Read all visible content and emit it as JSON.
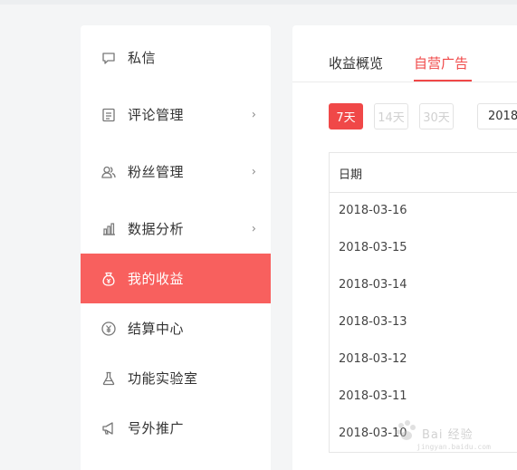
{
  "sidebar": {
    "items": [
      {
        "label": "私信",
        "icon": "message-icon",
        "has_chevron": false,
        "active": false
      },
      {
        "label": "评论管理",
        "icon": "comment-doc-icon",
        "has_chevron": true,
        "active": false
      },
      {
        "label": "粉丝管理",
        "icon": "users-icon",
        "has_chevron": true,
        "active": false
      },
      {
        "label": "数据分析",
        "icon": "bar-chart-icon",
        "has_chevron": true,
        "active": false
      },
      {
        "label": "我的收益",
        "icon": "money-bag-icon",
        "has_chevron": false,
        "active": true
      },
      {
        "label": "结算中心",
        "icon": "yen-circle-icon",
        "has_chevron": false,
        "active": false
      },
      {
        "label": "功能实验室",
        "icon": "flask-icon",
        "has_chevron": false,
        "active": false
      },
      {
        "label": "号外推广",
        "icon": "megaphone-icon",
        "has_chevron": false,
        "active": false
      }
    ],
    "chevron": "›"
  },
  "main": {
    "tabs": [
      {
        "label": "收益概览",
        "active": false
      },
      {
        "label": "自营广告",
        "active": true
      }
    ],
    "range_buttons": [
      {
        "label": "7天",
        "active": true
      },
      {
        "label": "14天",
        "active": false
      },
      {
        "label": "30天",
        "active": false
      }
    ],
    "date_value": "2018",
    "table": {
      "header": "日期",
      "rows": [
        "2018-03-16",
        "2018-03-15",
        "2018-03-14",
        "2018-03-13",
        "2018-03-12",
        "2018-03-11",
        "2018-03-10"
      ]
    }
  },
  "watermark": {
    "text": "Bai 经验",
    "url": "jingyan.baidu.com"
  },
  "colors": {
    "accent": "#f04848",
    "active_bg": "#f8605e",
    "page_bg": "#f4f5f6"
  }
}
